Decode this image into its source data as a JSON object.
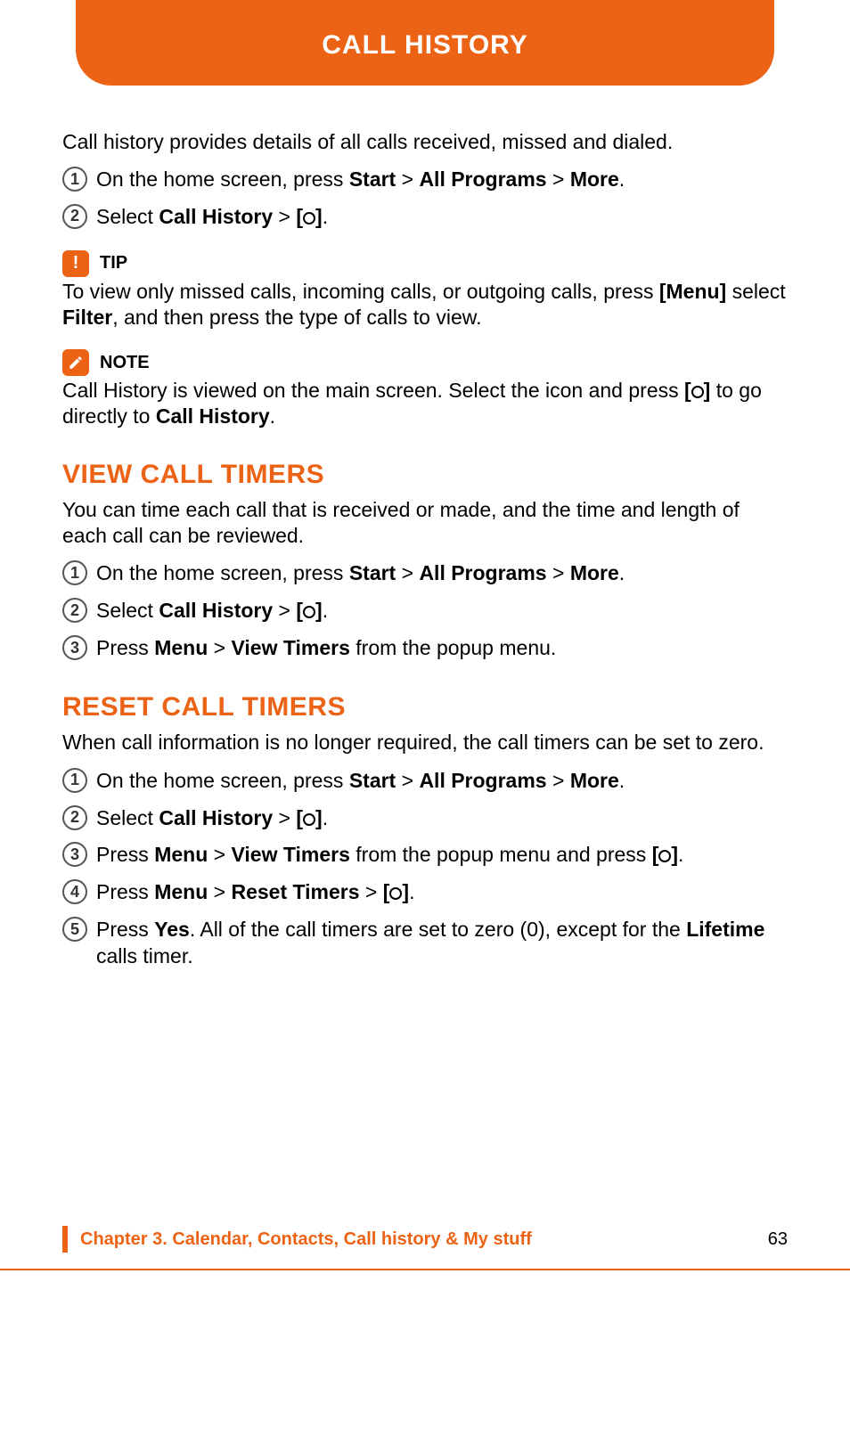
{
  "header": {
    "title": "CALL HISTORY"
  },
  "intro": "Call history provides details of all calls received, missed and dialed.",
  "initial_steps": [
    {
      "num": "1",
      "parts": [
        "On the home screen, press ",
        "Start",
        " > ",
        "All Programs",
        " > ",
        "More",
        "."
      ]
    },
    {
      "num": "2",
      "parts": [
        "Select ",
        "Call History",
        " > ",
        "[",
        "CIRCLE",
        "]",
        "."
      ]
    }
  ],
  "tip": {
    "label": "TIP",
    "parts": [
      "To view only missed calls, incoming calls, or outgoing calls, press ",
      "[Menu]",
      " select ",
      "Filter",
      ", and then press the type of calls to view."
    ]
  },
  "note": {
    "label": "NOTE",
    "parts": [
      "Call History is viewed on the main screen. Select the icon and press ",
      "[",
      "CIRCLE",
      "]",
      " to go directly to ",
      "Call History",
      "."
    ]
  },
  "sections": [
    {
      "heading": "VIEW CALL TIMERS",
      "intro": "You can time each call that is received or made, and the time and length of each call can be reviewed.",
      "steps": [
        {
          "num": "1",
          "parts": [
            "On the home screen, press ",
            "Start",
            " > ",
            "All Programs",
            " > ",
            "More",
            "."
          ]
        },
        {
          "num": "2",
          "parts": [
            "Select ",
            "Call History",
            " > ",
            "[",
            "CIRCLE",
            "]",
            "."
          ]
        },
        {
          "num": "3",
          "parts": [
            "Press ",
            "Menu",
            " > ",
            "View Timers",
            " from the popup menu."
          ]
        }
      ]
    },
    {
      "heading": "RESET CALL TIMERS",
      "intro": "When call information is no longer required, the call timers can be set to zero.",
      "steps": [
        {
          "num": "1",
          "parts": [
            "On the home screen, press ",
            "Start",
            " > ",
            "All Programs",
            " > ",
            "More",
            "."
          ]
        },
        {
          "num": "2",
          "parts": [
            "Select ",
            "Call History",
            " > ",
            "[",
            "CIRCLE",
            "]",
            "."
          ]
        },
        {
          "num": "3",
          "parts": [
            "Press ",
            "Menu",
            " > ",
            "View Timers",
            " from the popup menu and press ",
            "[",
            "CIRCLE",
            "]",
            "."
          ]
        },
        {
          "num": "4",
          "parts": [
            "Press ",
            "Menu",
            " > ",
            "Reset Timers",
            " > ",
            "[",
            "CIRCLE",
            "]",
            "."
          ]
        },
        {
          "num": "5",
          "parts": [
            "Press ",
            "Yes",
            ". All of the call timers are set to zero (0), except for the ",
            "Lifetime",
            " calls timer."
          ]
        }
      ]
    }
  ],
  "footer": {
    "chapter": "Chapter 3. Calendar, Contacts, Call history & My stuff",
    "page": "63"
  }
}
